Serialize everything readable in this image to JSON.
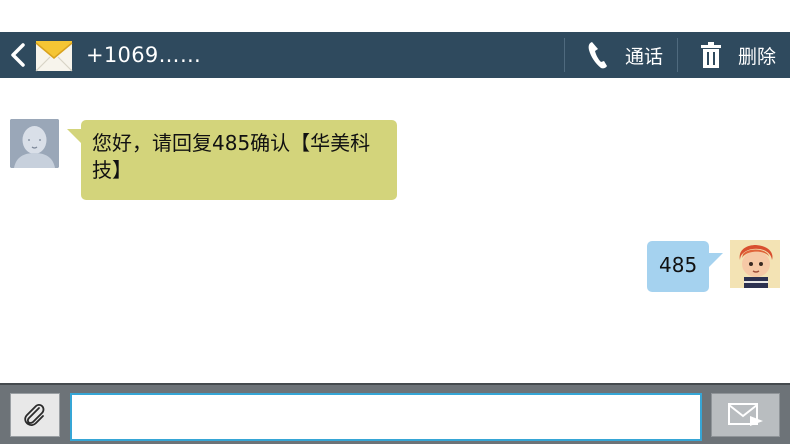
{
  "header": {
    "title": "+1069……",
    "call_label": "通话",
    "delete_label": "删除"
  },
  "messages": [
    {
      "direction": "incoming",
      "text": "您好，请回复485确认【华美科技】"
    },
    {
      "direction": "outgoing",
      "text": "485"
    }
  ],
  "compose": {
    "value": "",
    "placeholder": ""
  },
  "colors": {
    "actionbar": "#2f4a5e",
    "incoming_bubble": "#d3d47b",
    "outgoing_bubble": "#a5d2ef",
    "input_border": "#36a6d6"
  }
}
